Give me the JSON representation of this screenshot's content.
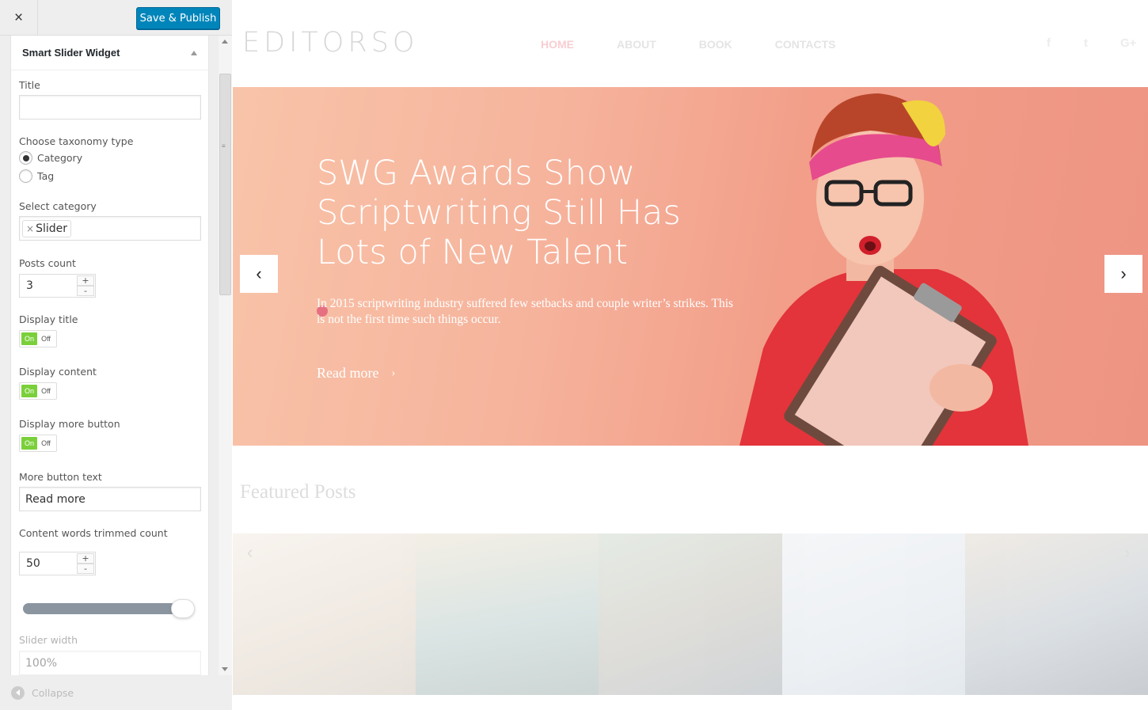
{
  "customizer": {
    "header": {
      "close_label": "×",
      "publish_label": "Save & Publish"
    },
    "widget": {
      "title": "Smart Slider Widget",
      "fields": {
        "title_label": "Title",
        "title_value": "",
        "taxonomy_label": "Choose taxonomy type",
        "taxonomy_options": [
          "Category",
          "Tag"
        ],
        "taxonomy_selected": "Category",
        "category_label": "Select category",
        "category_tag": "Slider",
        "category_tag_remove": "×",
        "posts_count_label": "Posts count",
        "posts_count_value": "3",
        "display_title_label": "Display title",
        "display_content_label": "Display content",
        "display_more_label": "Display more button",
        "toggle_on": "On",
        "toggle_off": "Off",
        "more_text_label": "More button text",
        "more_text_value": "Read more",
        "trim_label": "Content words trimmed count",
        "trim_value": "50",
        "slider_width_label": "Slider width",
        "slider_width_value": "100%",
        "spin_up": "+",
        "spin_down": "-"
      },
      "states": {
        "display_title": true,
        "display_content": true,
        "display_more": true
      },
      "range_level": 0.9
    },
    "footer": {
      "collapse_label": "Collapse"
    }
  },
  "preview": {
    "logo": "EDITORSO",
    "nav": [
      "HOME",
      "ABOUT",
      "BOOK",
      "CONTACTS"
    ],
    "nav_active": "HOME",
    "social": [
      "f",
      "t",
      "G+"
    ],
    "hero": {
      "title": "SWG Awards Show Scriptwriting Still Has Lots of New Talent",
      "text": "In 2015 scriptwriting industry suffered few setbacks and couple writer’s strikes. This is not the first time such things occur.",
      "more": "Read more",
      "more_chevron": "›",
      "prev": "‹",
      "next": "›"
    },
    "featured_title": "Featured Posts",
    "strip_prev": "‹",
    "strip_next": "›"
  },
  "colors": {
    "publish_button": "#0085ba",
    "toggle_on": "#7ad03a",
    "nav_active": "#f9cdd2",
    "hero_bg": "#f4ab94"
  }
}
